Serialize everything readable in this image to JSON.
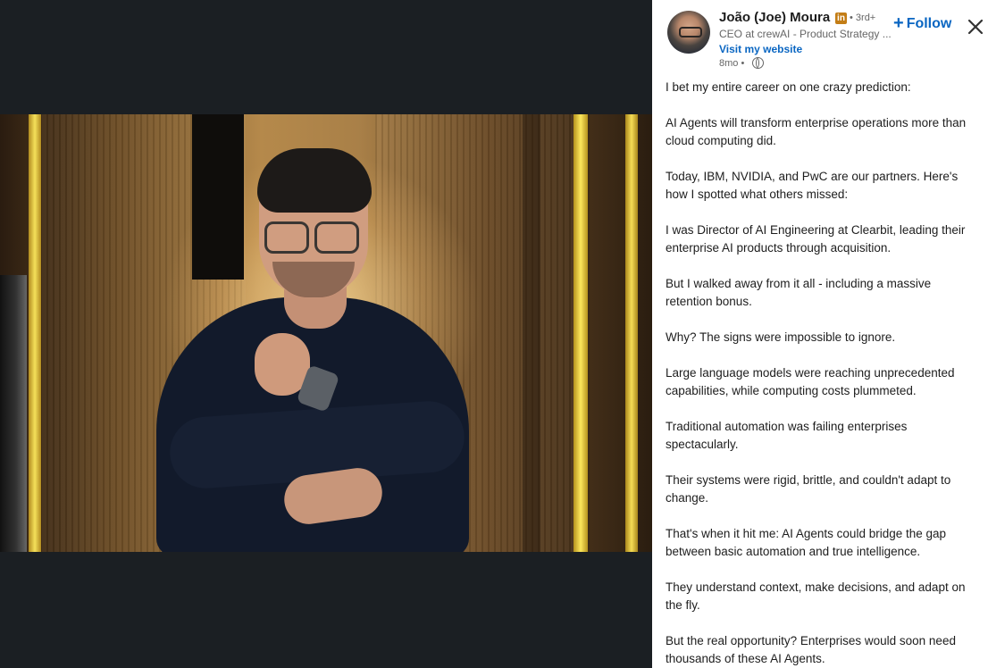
{
  "author": {
    "name": "João (Joe) Moura",
    "badge": "in",
    "degree": "• 3rd+",
    "headline": "CEO at crewAI - Product Strategy ...",
    "website_link": "Visit my website",
    "timestamp": "8mo •",
    "visibility_icon": "globe-icon"
  },
  "actions": {
    "follow_label": "Follow",
    "follow_icon": "+",
    "close_icon": "close-icon"
  },
  "post": {
    "paragraphs": [
      "I bet my entire career on one crazy prediction:",
      "AI Agents will transform enterprise operations more than cloud computing did.",
      "Today, IBM, NVIDIA, and PwC are our partners. Here's how I spotted what others missed:",
      "I was Director of AI Engineering at Clearbit, leading their enterprise AI products through acquisition.",
      "But I walked away from it all - including a massive retention bonus.",
      "Why? The signs were impossible to ignore.",
      "Large language models were reaching unprecedented capabilities, while computing costs plummeted.",
      "Traditional automation was failing enterprises spectacularly.",
      "Their systems were rigid, brittle, and couldn't adapt to change.",
      "That's when it hit me: AI Agents could bridge the gap between basic automation and true intelligence.",
      "They understand context, make decisions, and adapt on the fly.",
      "But the real opportunity? Enterprises would soon need thousands of these AI Agents."
    ]
  },
  "colors": {
    "link_blue": "#0a66c2",
    "viewer_bg": "#1b1f23",
    "badge_gold": "#c37d16"
  }
}
